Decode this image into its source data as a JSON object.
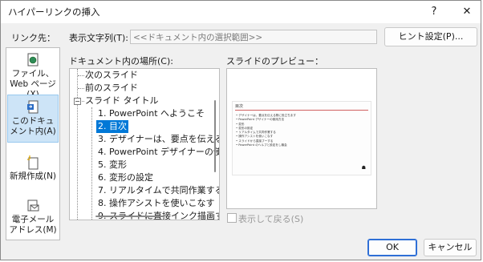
{
  "window": {
    "title": "ハイパーリンクの挿入",
    "help_label": "?",
    "close_label": "✕"
  },
  "link_to": {
    "label": "リンク先：",
    "items": [
      {
        "label": "ファイル、Web ページ(X)",
        "icon": "file-web-icon",
        "selected": false
      },
      {
        "label": "このドキュメント内(A)",
        "icon": "document-place-icon",
        "selected": true
      },
      {
        "label": "新規作成(N)",
        "icon": "new-document-icon",
        "selected": false
      },
      {
        "label": "電子メール アドレス(M)",
        "icon": "email-icon",
        "selected": false
      }
    ]
  },
  "display_text": {
    "label": "表示文字列(T):",
    "value": "<<ドキュメント内の選択範囲>>"
  },
  "screentip_button": "ヒント設定(P)...",
  "place_label": "ドキュメント内の場所(C):",
  "tree": {
    "items": [
      {
        "label": "次のスライド"
      },
      {
        "label": "前のスライド"
      },
      {
        "label": "スライド タイトル",
        "expander": "−"
      },
      {
        "label": "1. PowerPoint へようこそ"
      },
      {
        "label": "2. 目次",
        "selected": true
      },
      {
        "label": "3. デザイナーは、要点を伝える指"
      },
      {
        "label": "4. PowerPoint デザイナーの使"
      },
      {
        "label": "5. 変形"
      },
      {
        "label": "6. 変形の設定"
      },
      {
        "label": "7. リアルタイムで共同作業する"
      },
      {
        "label": "8. 操作アシストを使いこなす"
      },
      {
        "label": "9. スライドに直接インク描画する"
      }
    ]
  },
  "preview": {
    "label": "スライドのプレビュー：",
    "slide_title": "目次",
    "bullets": [
      "デザイナーは、要点を伝える際に役立ちます",
      "PowerPoint デザイナーの使用方法",
      "変形",
      "変形の設定",
      "リアルタイムで共同作業する",
      "操作アシストを使いこなす",
      "スライドから直接ブーする",
      "PowerPoint のヘルプと設定をし機会"
    ]
  },
  "show_and_return": {
    "label": "表示して戻る(S)",
    "checked": false
  },
  "buttons": {
    "ok": "OK",
    "cancel": "キャンセル"
  },
  "colors": {
    "selection": "#0078d7",
    "primary_border": "#2f6fd6",
    "link_selected_bg": "#cde4f7"
  }
}
